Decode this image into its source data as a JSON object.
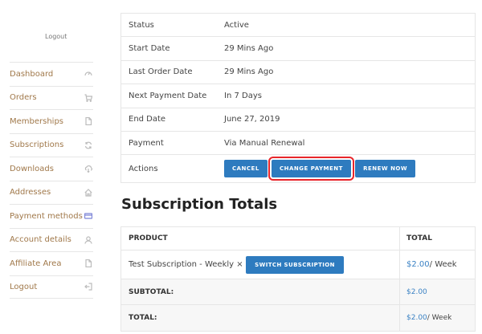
{
  "sidebar": {
    "logout_top": "Logout",
    "items": [
      {
        "label": "Dashboard",
        "icon": "dashboard-icon"
      },
      {
        "label": "Orders",
        "icon": "cart-icon"
      },
      {
        "label": "Memberships",
        "icon": "document-icon"
      },
      {
        "label": "Subscriptions",
        "icon": "refresh-icon"
      },
      {
        "label": "Downloads",
        "icon": "download-cloud-icon"
      },
      {
        "label": "Addresses",
        "icon": "home-icon"
      },
      {
        "label": "Payment methods",
        "icon": "credit-card-icon"
      },
      {
        "label": "Account details",
        "icon": "user-icon"
      },
      {
        "label": "Affiliate Area",
        "icon": "document-icon"
      },
      {
        "label": "Logout",
        "icon": "logout-icon"
      }
    ]
  },
  "details": {
    "status_label": "Status",
    "status_value": "Active",
    "start_label": "Start Date",
    "start_value": "29 Mins Ago",
    "last_label": "Last Order Date",
    "last_value": "29 Mins Ago",
    "next_label": "Next Payment Date",
    "next_value": "In 7 Days",
    "end_label": "End Date",
    "end_value": "June 27, 2019",
    "payment_label": "Payment",
    "payment_value": "Via Manual Renewal",
    "actions_label": "Actions",
    "cancel": "Cancel",
    "change_payment": "Change Payment",
    "renew_now": "Renew Now"
  },
  "totals": {
    "title": "Subscription Totals",
    "col_product": "PRODUCT",
    "col_total": "TOTAL",
    "item_name": "Test Subscription - Weekly × 1",
    "switch_label": "Switch Subscription",
    "item_price": "$2.00",
    "item_period": " / Week",
    "subtotal_label": "SUBTOTAL:",
    "subtotal_value": "$2.00",
    "total_label": "TOTAL:",
    "total_price": "$2.00",
    "total_period": " / Week"
  },
  "colors": {
    "accent_button": "#2e7bbf",
    "link": "#3b82c4",
    "nav_text": "#a0784a",
    "highlight_box": "#e8262b"
  }
}
